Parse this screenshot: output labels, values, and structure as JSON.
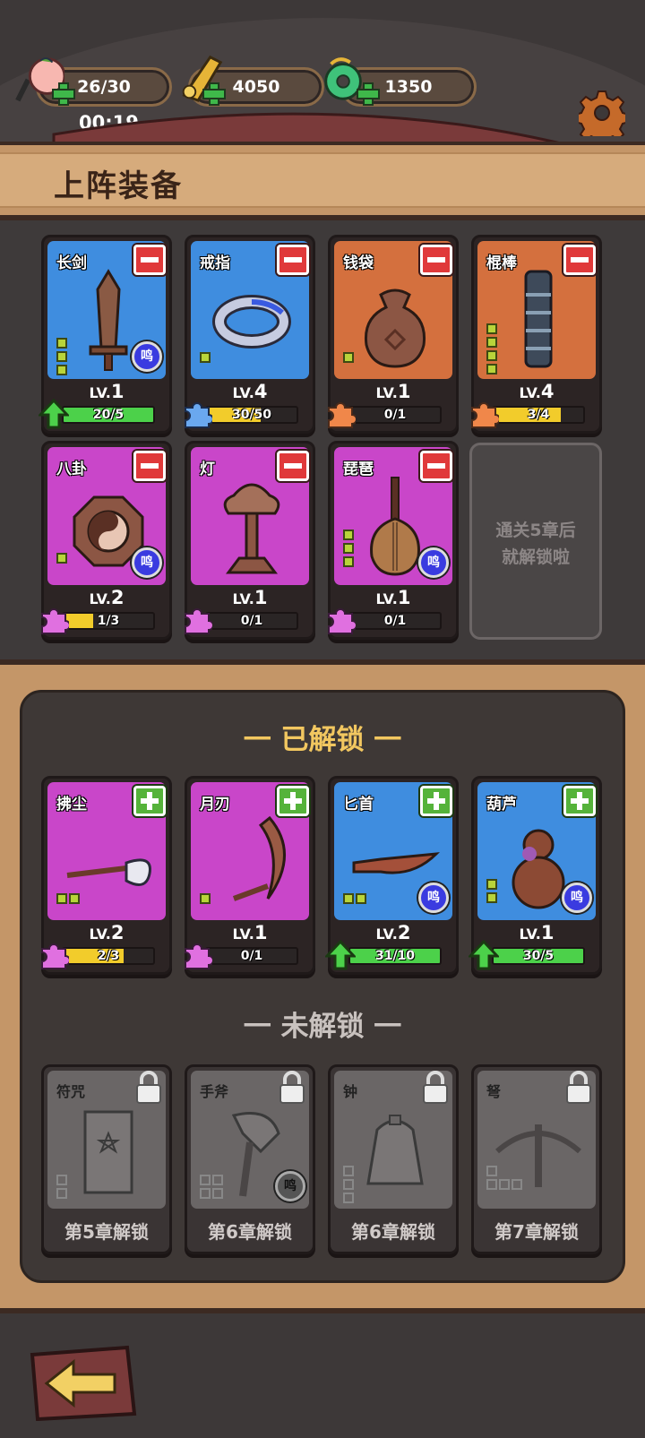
{
  "resources": [
    {
      "name": "peach",
      "value": "26/30"
    },
    {
      "name": "gold-ticket",
      "value": "4050"
    },
    {
      "name": "jade",
      "value": "1350"
    }
  ],
  "timer": "00:19",
  "banner": {
    "title": "上阵装备"
  },
  "equipped": [
    {
      "name": "长剑",
      "rarity": "blue",
      "level_prefix": "LV.",
      "level": "1",
      "progress": "20/5",
      "progress_fraction": 1.0,
      "bar_color": "#4cd14a",
      "badge": "upgrade-arrow-icon",
      "ming": true,
      "pips": 3
    },
    {
      "name": "戒指",
      "rarity": "blue",
      "level_prefix": "LV.",
      "level": "4",
      "progress": "30/50",
      "progress_fraction": 0.6,
      "bar_color": "#f2cc2b",
      "badge": "puzzle-blue-icon",
      "ming": false,
      "pips": 1
    },
    {
      "name": "钱袋",
      "rarity": "red",
      "level_prefix": "LV.",
      "level": "1",
      "progress": "0/1",
      "progress_fraction": 0,
      "bar_color": "#f2cc2b",
      "badge": "puzzle-orange-icon",
      "ming": false,
      "pips": 1
    },
    {
      "name": "棍棒",
      "rarity": "red",
      "level_prefix": "LV.",
      "level": "4",
      "progress": "3/4",
      "progress_fraction": 0.75,
      "bar_color": "#f2cc2b",
      "badge": "puzzle-orange-icon",
      "ming": false,
      "pips": 4
    },
    {
      "name": "八卦",
      "rarity": "purple",
      "level_prefix": "LV.",
      "level": "2",
      "progress": "1/3",
      "progress_fraction": 0.33,
      "bar_color": "#f2cc2b",
      "badge": "puzzle-purple-icon",
      "ming": true,
      "pips": 1
    },
    {
      "name": "灯",
      "rarity": "purple",
      "level_prefix": "LV.",
      "level": "1",
      "progress": "0/1",
      "progress_fraction": 0,
      "bar_color": "#f2cc2b",
      "badge": "puzzle-purple-icon",
      "ming": false,
      "pips": 0
    },
    {
      "name": "琵琶",
      "rarity": "purple",
      "level_prefix": "LV.",
      "level": "1",
      "progress": "0/1",
      "progress_fraction": 0,
      "bar_color": "#f2cc2b",
      "badge": "puzzle-purple-icon",
      "ming": true,
      "pips": 3
    }
  ],
  "locked_slot": {
    "line1": "通关5章后",
    "line2": "就解锁啦"
  },
  "sections": {
    "unlocked": "一 已解锁 一",
    "locked": "一 未解锁 一"
  },
  "ming_label": "鸣",
  "unlocked": [
    {
      "name": "拂尘",
      "rarity": "purple",
      "level_prefix": "LV.",
      "level": "2",
      "progress": "2/3",
      "progress_fraction": 0.67,
      "bar_color": "#f2cc2b",
      "badge": "puzzle-purple-icon",
      "ming": false
    },
    {
      "name": "月刃",
      "rarity": "purple",
      "level_prefix": "LV.",
      "level": "1",
      "progress": "0/1",
      "progress_fraction": 0,
      "bar_color": "#f2cc2b",
      "badge": "puzzle-purple-icon",
      "ming": false
    },
    {
      "name": "匕首",
      "rarity": "blue",
      "level_prefix": "LV.",
      "level": "2",
      "progress": "31/10",
      "progress_fraction": 1.0,
      "bar_color": "#4cd14a",
      "badge": "upgrade-arrow-icon",
      "ming": true
    },
    {
      "name": "葫芦",
      "rarity": "blue",
      "level_prefix": "LV.",
      "level": "1",
      "progress": "30/5",
      "progress_fraction": 1.0,
      "bar_color": "#4cd14a",
      "badge": "upgrade-arrow-icon",
      "ming": true
    }
  ],
  "locked": [
    {
      "name": "符咒",
      "unlock": "第5章解锁",
      "ming": false
    },
    {
      "name": "手斧",
      "unlock": "第6章解锁",
      "ming": true
    },
    {
      "name": "钟",
      "unlock": "第6章解锁",
      "ming": false
    },
    {
      "name": "弩",
      "unlock": "第7章解锁",
      "ming": false
    }
  ],
  "colors": {
    "blue": "#3f8ddf",
    "red": "#d4703e",
    "purple": "#c946c9",
    "gold": "#f2c760"
  }
}
